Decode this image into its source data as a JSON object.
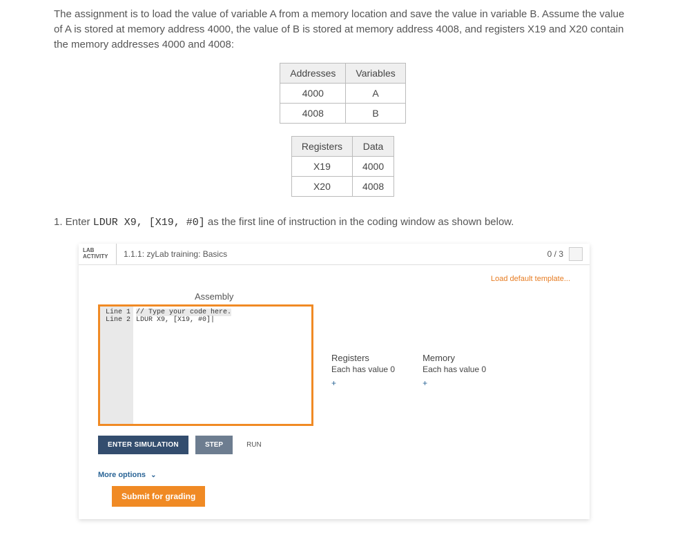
{
  "intro": "The assignment is to load the value of variable A from a memory location and save the value in variable B. Assume the value of A is stored at memory address 4000, the value of B is stored at memory address 4008, and registers X19 and X20 contain the memory addresses 4000 and 4008:",
  "table1": {
    "headers": [
      "Addresses",
      "Variables"
    ],
    "rows": [
      [
        "4000",
        "A"
      ],
      [
        "4008",
        "B"
      ]
    ]
  },
  "table2": {
    "headers": [
      "Registers",
      "Data"
    ],
    "rows": [
      [
        "X19",
        "4000"
      ],
      [
        "X20",
        "4008"
      ]
    ]
  },
  "instruction": {
    "prefix": "1. Enter ",
    "code": "LDUR X9, [X19, #0]",
    "suffix": " as the first line of instruction in the coding window as shown below."
  },
  "lab": {
    "badge_line1": "LAB",
    "badge_line2": "ACTIVITY",
    "title": "1.1.1: zyLab training: Basics",
    "score": "0 / 3",
    "load_template": "Load default template...",
    "assembly_label": "Assembly",
    "editor": {
      "gutter": "Line 1\nLine 2",
      "line1": "// Type your code here.",
      "line2": "LDUR X9, [X19, #0]|"
    },
    "registers": {
      "title": "Registers",
      "sub": "Each has value 0",
      "plus": "+"
    },
    "memory": {
      "title": "Memory",
      "sub": "Each has value 0",
      "plus": "+"
    },
    "buttons": {
      "enter_sim": "ENTER SIMULATION",
      "step": "STEP",
      "run": "RUN"
    },
    "more_options": "More options",
    "submit": "Submit for grading"
  }
}
